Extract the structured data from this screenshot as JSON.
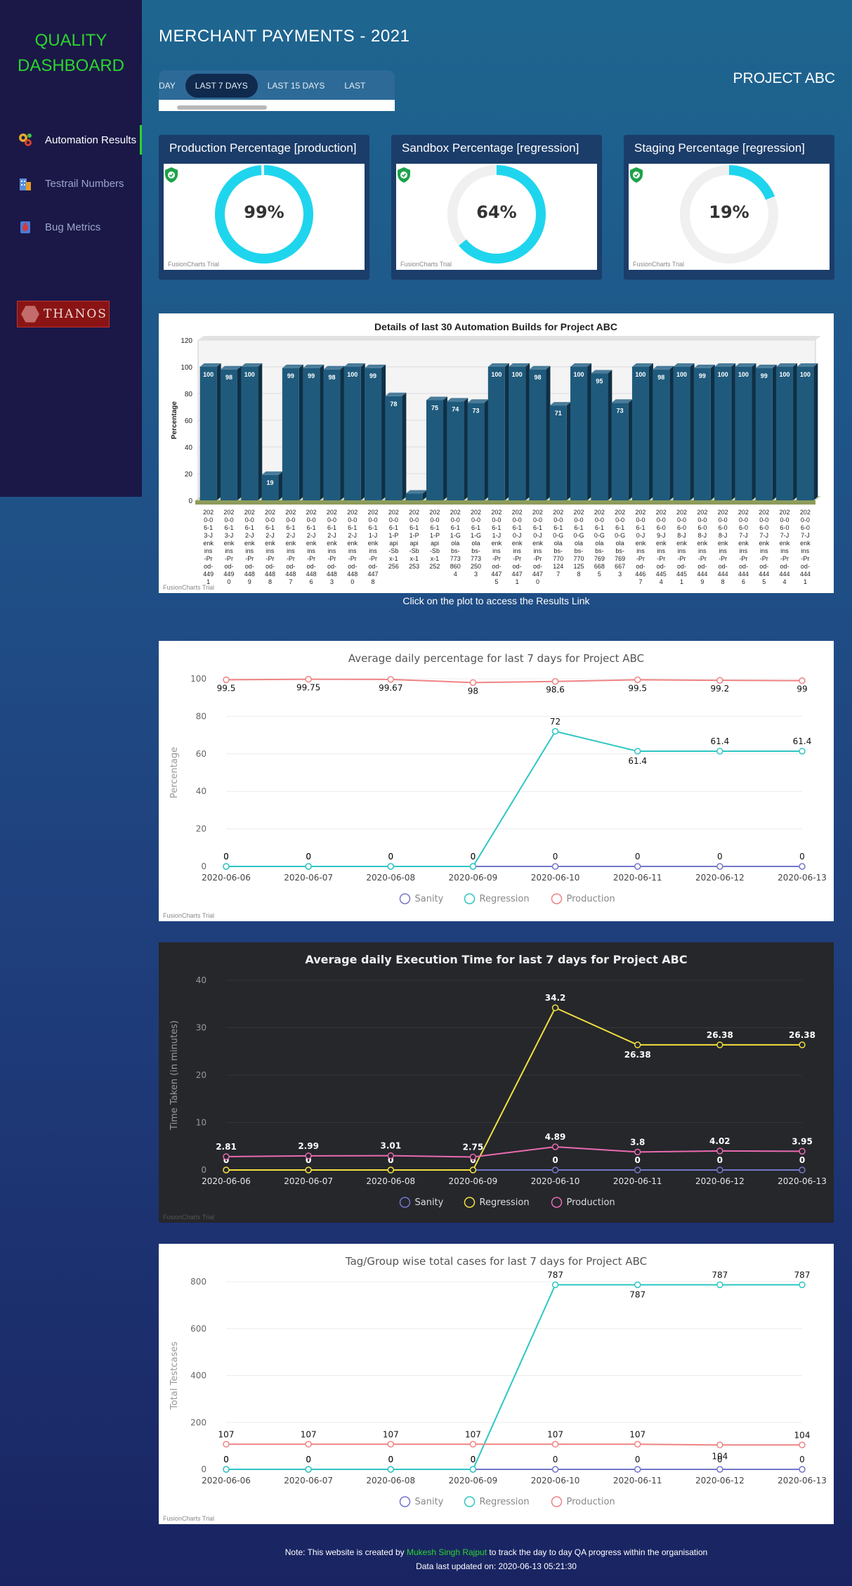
{
  "sidebar": {
    "brand_line1": "QUALITY",
    "brand_line2": "DASHBOARD",
    "items": [
      {
        "label": "Automation Results",
        "icon": "gears-icon",
        "active": true
      },
      {
        "label": "Testrail Numbers",
        "icon": "building-icon",
        "active": false
      },
      {
        "label": "Bug Metrics",
        "icon": "bug-icon",
        "active": false
      }
    ],
    "logo_text": "THANOS"
  },
  "header": {
    "title": "MERCHANT PAYMENTS - 2021",
    "project": "PROJECT ABC",
    "tabs": [
      "DAY",
      "LAST 7 DAYS",
      "LAST 15 DAYS",
      "LAST"
    ],
    "active_tab": "LAST 7 DAYS"
  },
  "gauges": [
    {
      "title": "Production Percentage [production]",
      "value_label": "99%",
      "value": 99,
      "trial": "FusionCharts Trial"
    },
    {
      "title": "Sandbox Percentage [regression]",
      "value_label": "64%",
      "value": 64,
      "trial": "FusionCharts Trial"
    },
    {
      "title": "Staging Percentage [regression]",
      "value_label": "19%",
      "value": 19,
      "trial": "FusionCharts Trial"
    }
  ],
  "colors": {
    "gauge_fill": "#1fd5ee",
    "gauge_track": "#f0f0f0",
    "accent": "#2bd62b",
    "sanity": "#7276c9",
    "regression": "#2ec6c3",
    "production": "#ef8383",
    "regression_dark": "#f3e03f",
    "production_dark": "#e96ab0"
  },
  "bar_caption": "Click on the plot to access the Results Link",
  "trial_text": "FusionCharts Trial",
  "footer": {
    "note_prefix": "Note: This website is created by ",
    "author": "Mukesh Singh Rajput",
    "note_suffix": " to track the day to day QA progress within the organisation",
    "updated": "Data last updated on: 2020-06-13 05:21:30"
  },
  "chart_data": [
    {
      "type": "bar",
      "title": "Details of last 30 Automation Builds for Project ABC",
      "ylabel": "Percentage",
      "ylim": [
        0,
        120
      ],
      "yticks": [
        0,
        20,
        40,
        60,
        80,
        100,
        120
      ],
      "categories": [
        "2020-06-13-Jenkins-Prod-4491",
        "2020-06-13-Jenkins-Prod-4490",
        "2020-06-12-Jenkins-Prod-4489",
        "2020-06-12-Jenkins-Prod-4488",
        "2020-06-12-Jenkins-Prod-4487",
        "2020-06-12-Jenkins-Prod-4486",
        "2020-06-12-Jenkins-Prod-4483",
        "2020-06-12-Jenkins-Prod-4480",
        "2020-06-11-Jenkins-Prod-4478",
        "2020-06-11-Papi-Sbx-1256",
        "2020-06-11-Papi-Sbx-1253",
        "2020-06-11-Papi-Sbx-1252",
        "2020-06-11-Golabs-7738604",
        "2020-06-11-Golabs-7732503",
        "2020-06-11-Jenkins-Prod-4475",
        "2020-06-10-Jenkins-Prod-4471",
        "2020-06-10-Jenkins-Prod-4470",
        "2020-06-10-Golabs-7701247",
        "2020-06-10-Golabs-7701258",
        "2020-06-10-Golabs-7696685",
        "2020-06-10-Golabs-7696673",
        "2020-06-10-Jenkins-Prod-4467",
        "2020-06-09-Jenkins-Prod-4454",
        "2020-06-08-Jenkins-Prod-4451",
        "2020-06-08-Jenkins-Prod-4449",
        "2020-06-08-Jenkins-Prod-4448",
        "2020-06-07-Jenkins-Prod-4446",
        "2020-06-07-Jenkins-Prod-4445",
        "2020-06-07-Jenkins-Prod-4444",
        "2020-06-07-Jenkins-Prod-4441"
      ],
      "values": [
        100,
        98,
        100,
        19,
        99,
        99,
        98,
        100,
        99,
        78,
        5,
        75,
        74,
        73,
        100,
        100,
        98,
        71,
        100,
        95,
        73,
        100,
        98,
        100,
        99,
        100,
        100,
        99,
        100,
        100
      ],
      "value_labels": [
        "100",
        "98",
        "100",
        "19",
        "99",
        "99",
        "98",
        "100",
        "99",
        "78",
        "",
        "75",
        "74",
        "73",
        "100",
        "100",
        "98",
        "71",
        "100",
        "95",
        "73",
        "100",
        "98",
        "100",
        "99",
        "100",
        "100",
        "99",
        "100",
        "100"
      ],
      "bar_color": "#1f5a7c",
      "grid": true
    },
    {
      "type": "line",
      "title": "Average daily percentage for last 7 days for Project ABC",
      "ylabel": "Percentage",
      "ylim": [
        0,
        100
      ],
      "yticks": [
        0,
        20,
        40,
        60,
        80,
        100
      ],
      "categories": [
        "2020-06-06",
        "2020-06-07",
        "2020-06-08",
        "2020-06-09",
        "2020-06-10",
        "2020-06-11",
        "2020-06-12",
        "2020-06-13"
      ],
      "series": [
        {
          "name": "Sanity",
          "values": [
            0,
            0,
            0,
            0,
            0,
            0,
            0,
            0
          ]
        },
        {
          "name": "Regression",
          "values": [
            0,
            0,
            0,
            0,
            72,
            61.4,
            61.4,
            61.4
          ]
        },
        {
          "name": "Production",
          "values": [
            99.5,
            99.75,
            99.67,
            98,
            98.6,
            99.5,
            99.2,
            99
          ]
        }
      ],
      "legend": "bottom",
      "theme": "light"
    },
    {
      "type": "line",
      "title": "Average daily Execution Time for last 7 days for Project ABC",
      "ylabel": "Time Taken (in minutes)",
      "ylim": [
        0,
        40
      ],
      "yticks": [
        0,
        10,
        20,
        30,
        40
      ],
      "categories": [
        "2020-06-06",
        "2020-06-07",
        "2020-06-08",
        "2020-06-09",
        "2020-06-10",
        "2020-06-11",
        "2020-06-12",
        "2020-06-13"
      ],
      "series": [
        {
          "name": "Sanity",
          "values": [
            0,
            0,
            0,
            0,
            0,
            0,
            0,
            0
          ]
        },
        {
          "name": "Regression",
          "values": [
            0,
            0,
            0,
            0,
            34.2,
            26.38,
            26.38,
            26.38
          ]
        },
        {
          "name": "Production",
          "values": [
            2.81,
            2.99,
            3.01,
            2.75,
            4.89,
            3.8,
            4.02,
            3.95
          ]
        }
      ],
      "legend": "bottom",
      "theme": "dark"
    },
    {
      "type": "line",
      "title": "Tag/Group wise total cases for last 7 days for Project ABC",
      "ylabel": "Total Testcases",
      "ylim": [
        0,
        800
      ],
      "yticks": [
        0,
        200,
        400,
        600,
        800
      ],
      "categories": [
        "2020-06-06",
        "2020-06-07",
        "2020-06-08",
        "2020-06-09",
        "2020-06-10",
        "2020-06-11",
        "2020-06-12",
        "2020-06-13"
      ],
      "series": [
        {
          "name": "Sanity",
          "values": [
            0,
            0,
            0,
            0,
            0,
            0,
            0,
            0
          ]
        },
        {
          "name": "Regression",
          "values": [
            0,
            0,
            0,
            0,
            787,
            787,
            787,
            787
          ]
        },
        {
          "name": "Production",
          "values": [
            107,
            107,
            107,
            107,
            107,
            107,
            104,
            104
          ]
        }
      ],
      "legend": "bottom",
      "theme": "light"
    }
  ]
}
